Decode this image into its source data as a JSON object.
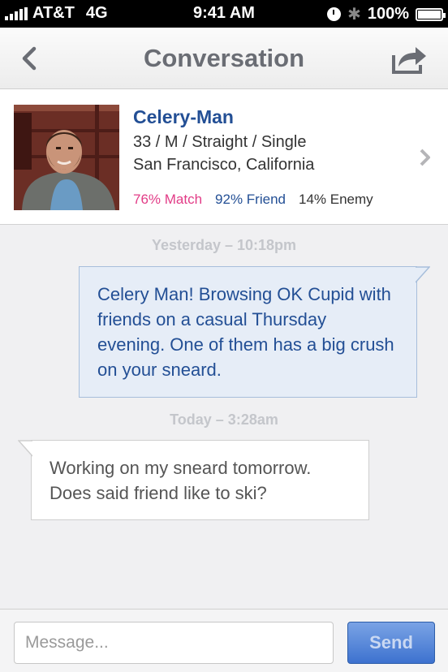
{
  "status_bar": {
    "carrier": "AT&T",
    "network": "4G",
    "time": "9:41 AM",
    "battery": "100%"
  },
  "nav": {
    "title": "Conversation",
    "back_icon": "chevron-left-icon",
    "share_icon": "share-icon"
  },
  "profile": {
    "name": "Celery-Man",
    "details": "33 / M / Straight / Single",
    "location": "San Francisco, California",
    "match": "76% Match",
    "friend": "92% Friend",
    "enemy": "14% Enemy"
  },
  "thread": [
    {
      "timestamp": "Yesterday – 10:18pm",
      "direction": "outgoing",
      "text": "Celery Man! Browsing OK Cupid with friends on a casual Thursday evening. One of them has a big crush on your sneard."
    },
    {
      "timestamp": "Today – 3:28am",
      "direction": "incoming",
      "text": "Working on my sneard tomorrow. Does said friend like to ski?"
    }
  ],
  "composer": {
    "placeholder": "Message...",
    "value": "",
    "send_label": "Send"
  },
  "colors": {
    "accent_blue": "#234f95",
    "match_pink": "#e23c87",
    "send_button": "#3d72cf",
    "outgoing_bubble": "#e6edf7"
  }
}
